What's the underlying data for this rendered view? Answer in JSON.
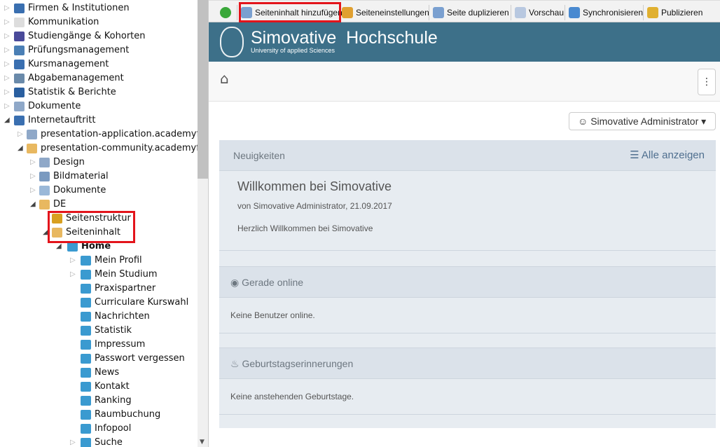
{
  "tree": [
    {
      "label": "Firmen & Institutionen",
      "level": 0,
      "exp": "closed",
      "icon": "factory-icon",
      "color": "#3a6fb0"
    },
    {
      "label": "Kommunikation",
      "level": 0,
      "exp": "closed",
      "icon": "envelope-icon",
      "color": "#ddd"
    },
    {
      "label": "Studiengänge & Kohorten",
      "level": 0,
      "exp": "closed",
      "icon": "feather-icon",
      "color": "#4a4a9a"
    },
    {
      "label": "Prüfungsmanagement",
      "level": 0,
      "exp": "closed",
      "icon": "checklist-icon",
      "color": "#4a7fb5"
    },
    {
      "label": "Kursmanagement",
      "level": 0,
      "exp": "closed",
      "icon": "book-icon",
      "color": "#3a6fb0"
    },
    {
      "label": "Abgabemanagement",
      "level": 0,
      "exp": "closed",
      "icon": "id-card-icon",
      "color": "#6a8aaa"
    },
    {
      "label": "Statistik & Berichte",
      "level": 0,
      "exp": "closed",
      "icon": "bar-chart-icon",
      "color": "#2a5fa0"
    },
    {
      "label": "Dokumente",
      "level": 0,
      "exp": "closed",
      "icon": "folder-icon",
      "color": "#8fa8c8"
    },
    {
      "label": "Internetauftritt",
      "level": 0,
      "exp": "open",
      "icon": "globe-icon",
      "color": "#3a6fb0"
    },
    {
      "label": "presentation-application.academyfive",
      "level": 1,
      "exp": "closed",
      "icon": "folder-icon",
      "color": "#8fa8c8"
    },
    {
      "label": "presentation-community.academyfive",
      "level": 1,
      "exp": "open",
      "icon": "folder-open-icon",
      "color": "#e8b860"
    },
    {
      "label": "Design",
      "level": 2,
      "exp": "closed",
      "icon": "folder-icon",
      "color": "#8fa8c8"
    },
    {
      "label": "Bildmaterial",
      "level": 2,
      "exp": "closed",
      "icon": "image-icon",
      "color": "#7a9ac0"
    },
    {
      "label": "Dokumente",
      "level": 2,
      "exp": "closed",
      "icon": "documents-icon",
      "color": "#9ab8d8"
    },
    {
      "label": "DE",
      "level": 2,
      "exp": "open",
      "icon": "folder-open-icon",
      "color": "#e8b860"
    },
    {
      "label": "Seitenstruktur",
      "level": 3,
      "exp": "none",
      "icon": "key-structure-icon",
      "color": "#d8a020"
    },
    {
      "label": "Seiteninhalt",
      "level": 3,
      "exp": "open",
      "icon": "folder-open-icon",
      "color": "#e8b860"
    },
    {
      "label": "Home",
      "level": 4,
      "exp": "open",
      "icon": "page-icon",
      "color": "#3a9ad0",
      "bold": true
    },
    {
      "label": "Mein Profil",
      "level": 5,
      "exp": "closed",
      "icon": "page-icon",
      "color": "#3a9ad0"
    },
    {
      "label": "Mein Studium",
      "level": 5,
      "exp": "closed",
      "icon": "page-icon",
      "color": "#3a9ad0"
    },
    {
      "label": "Praxispartner",
      "level": 5,
      "exp": "none",
      "icon": "page-icon",
      "color": "#3a9ad0"
    },
    {
      "label": "Curriculare Kurswahl",
      "level": 5,
      "exp": "none",
      "icon": "page-icon",
      "color": "#3a9ad0"
    },
    {
      "label": "Nachrichten",
      "level": 5,
      "exp": "none",
      "icon": "page-icon",
      "color": "#3a9ad0"
    },
    {
      "label": "Statistik",
      "level": 5,
      "exp": "none",
      "icon": "page-icon",
      "color": "#3a9ad0"
    },
    {
      "label": "Impressum",
      "level": 5,
      "exp": "none",
      "icon": "page-icon",
      "color": "#3a9ad0"
    },
    {
      "label": "Passwort vergessen",
      "level": 5,
      "exp": "none",
      "icon": "page-icon",
      "color": "#3a9ad0"
    },
    {
      "label": "News",
      "level": 5,
      "exp": "none",
      "icon": "page-icon",
      "color": "#3a9ad0"
    },
    {
      "label": "Kontakt",
      "level": 5,
      "exp": "none",
      "icon": "page-icon",
      "color": "#3a9ad0"
    },
    {
      "label": "Ranking",
      "level": 5,
      "exp": "none",
      "icon": "page-icon",
      "color": "#3a9ad0"
    },
    {
      "label": "Raumbuchung",
      "level": 5,
      "exp": "none",
      "icon": "page-icon",
      "color": "#3a9ad0"
    },
    {
      "label": "Infopool",
      "level": 5,
      "exp": "none",
      "icon": "page-icon",
      "color": "#3a9ad0"
    },
    {
      "label": "Suche",
      "level": 5,
      "exp": "closed",
      "icon": "page-icon",
      "color": "#3a9ad0"
    }
  ],
  "toolbar": {
    "items": [
      {
        "label": "",
        "icon": "check-icon",
        "color": "#3aa83a"
      },
      {
        "label": "Seiteninhalt hinzufügen",
        "icon": "edit-page-icon",
        "color": "#7aa0d0"
      },
      {
        "label": "Seiteneinstellungen",
        "icon": "page-settings-icon",
        "color": "#e0a030"
      },
      {
        "label": "Seite duplizieren",
        "icon": "duplicate-icon",
        "color": "#7aa0d0"
      },
      {
        "label": "Vorschau",
        "icon": "preview-icon",
        "color": "#b8c8e0"
      },
      {
        "label": "Synchronisieren",
        "icon": "sync-icon",
        "color": "#4a8ad0"
      },
      {
        "label": "Publizieren",
        "icon": "publish-icon",
        "color": "#e0b030"
      }
    ]
  },
  "banner": {
    "title": "Simovative  Hochschule",
    "subtitle": "University of applied Sciences",
    "bg": "#3d7089"
  },
  "user_menu": {
    "label": "Simovative Administrator"
  },
  "news": {
    "header": "Neuigkeiten",
    "show_all": "Alle anzeigen",
    "title": "Willkommen bei Simovative",
    "meta": "von Simovative Administrator, 21.09.2017",
    "body": "Herzlich Willkommen bei Simovative"
  },
  "online": {
    "header": "Gerade online",
    "body": "Keine Benutzer online."
  },
  "birthdays": {
    "header": "Geburtstagserinnerungen",
    "body": "Keine anstehenden Geburtstage."
  },
  "highlight_color": "#e3141b"
}
